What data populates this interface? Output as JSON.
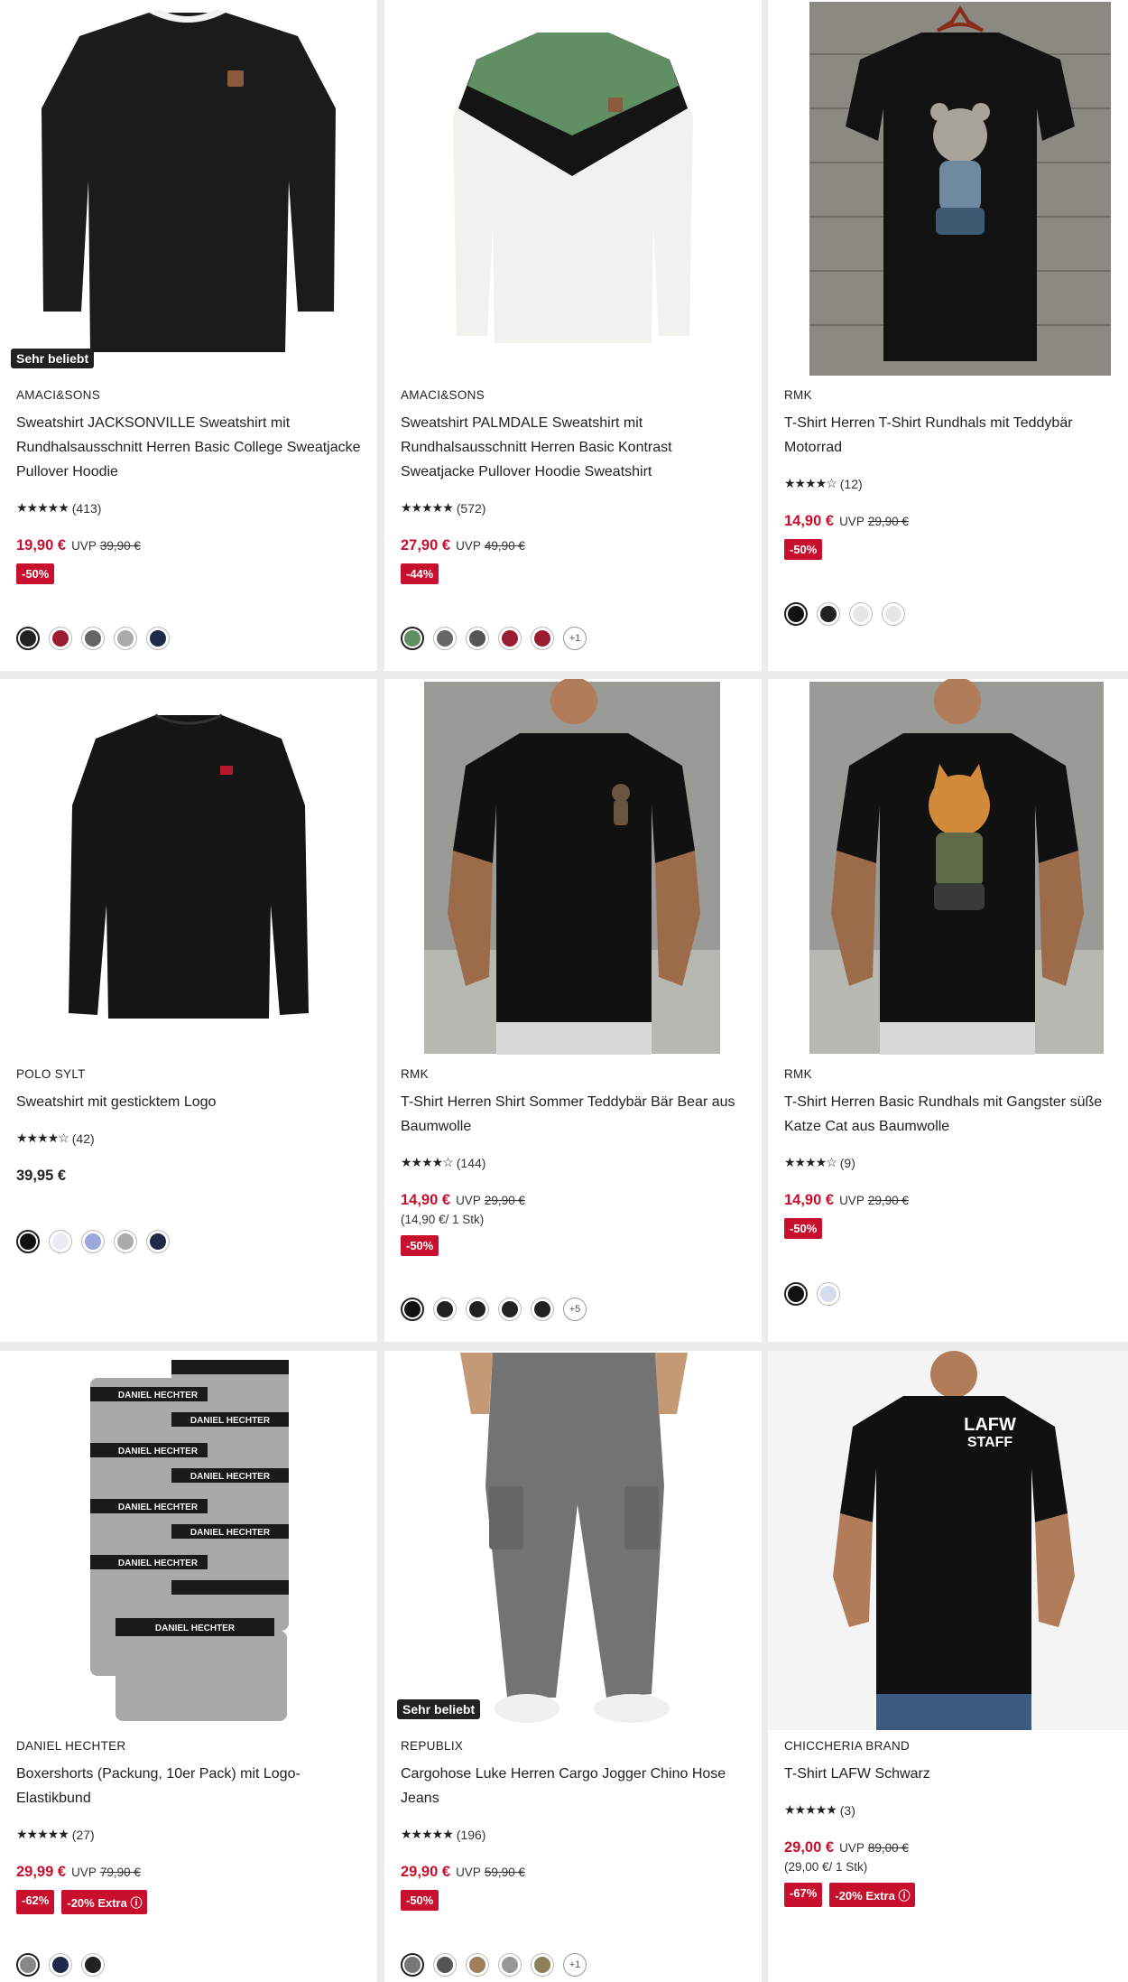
{
  "products": [
    {
      "brand": "AMACI&SONS",
      "title": "Sweatshirt JACKSONVILLE Sweatshirt mit Rundhalsausschnitt Herren Basic College Sweatjacke Pullover Hoodie",
      "badge": "Sehr beliebt",
      "stars": "★★★★★",
      "reviews": "(413)",
      "price": "19,90 €",
      "uvp_label": "UVP",
      "old_price": "39,90 €",
      "tags": [
        "-50%"
      ],
      "swatches": [
        "#222222",
        "#9b1b30",
        "#666666",
        "#aaaaaa",
        "#1e2a48"
      ],
      "more": ""
    },
    {
      "brand": "AMACI&SONS",
      "title": "Sweatshirt PALMDALE Sweatshirt mit Rundhalsausschnitt Herren Basic Kontrast Sweatjacke Pullover Hoodie Sweatshirt",
      "badge": "",
      "stars": "★★★★★",
      "reviews": "(572)",
      "price": "27,90 €",
      "uvp_label": "UVP",
      "old_price": "49,90 €",
      "tags": [
        "-44%"
      ],
      "swatches": [
        "#5f8f62",
        "#666666",
        "#555555",
        "#9b1b30",
        "#9b1b30"
      ],
      "more": "+1"
    },
    {
      "brand": "RMK",
      "title": "T-Shirt Herren T-Shirt Rundhals mit Teddybär Motorrad",
      "badge": "",
      "stars": "★★★★☆",
      "reviews": "(12)",
      "price": "14,90 €",
      "uvp_label": "UVP",
      "old_price": "29,90 €",
      "tags": [
        "-50%"
      ],
      "swatches": [
        "#111111",
        "#222222",
        "#e6e6e6",
        "#e6e6e6"
      ],
      "more": ""
    },
    {
      "brand": "POLO SYLT",
      "title": "Sweatshirt mit gesticktem Logo",
      "badge": "",
      "stars": "★★★★☆",
      "reviews": "(42)",
      "price": "39,95 €",
      "uvp_label": "",
      "old_price": "",
      "tags": [],
      "swatches": [
        "#111111",
        "#eceaf5",
        "#9aa8dc",
        "#aaaaaa",
        "#1e2a48"
      ],
      "more": ""
    },
    {
      "brand": "RMK",
      "title": "T-Shirt Herren Shirt Sommer Teddybär Bär Bear aus Baumwolle",
      "badge": "",
      "stars": "★★★★☆",
      "reviews": "(144)",
      "price": "14,90 €",
      "uvp_label": "UVP",
      "old_price": "29,90 €",
      "unit_price": "(14,90 €/ 1 Stk)",
      "tags": [
        "-50%"
      ],
      "swatches": [
        "#111111",
        "#222222",
        "#222222",
        "#222222",
        "#222222"
      ],
      "more": "+5"
    },
    {
      "brand": "RMK",
      "title": "T-Shirt Herren Basic Rundhals mit Gangster süße Katze Cat aus Baumwolle",
      "badge": "",
      "stars": "★★★★☆",
      "reviews": "(9)",
      "price": "14,90 €",
      "uvp_label": "UVP",
      "old_price": "29,90 €",
      "tags": [
        "-50%"
      ],
      "swatches": [
        "#111111",
        "#d5dcee"
      ],
      "more": ""
    },
    {
      "brand": "DANIEL HECHTER",
      "title": "Boxershorts (Packung, 10er Pack) mit Logo-Elastikbund",
      "badge": "",
      "stars": "★★★★★",
      "reviews": "(27)",
      "price": "29,99 €",
      "uvp_label": "UVP",
      "old_price": "79,90 €",
      "tags": [
        "-62%",
        "-20% Extra ⓘ"
      ],
      "swatches": [
        "#888888",
        "#1e2a48",
        "#222222"
      ],
      "more": ""
    },
    {
      "brand": "REPUBLIX",
      "title": "Cargohose Luke Herren Cargo Jogger Chino Hose Jeans",
      "badge": "Sehr beliebt",
      "stars": "★★★★★",
      "reviews": "(196)",
      "price": "29,90 €",
      "uvp_label": "UVP",
      "old_price": "59,90 €",
      "tags": [
        "-50%"
      ],
      "swatches": [
        "#777777",
        "#555555",
        "#a07e5a",
        "#999999",
        "#8f7e5a"
      ],
      "more": "+1"
    },
    {
      "brand": "CHICCHERIA BRAND",
      "title": "T-Shirt LAFW Schwarz",
      "badge": "",
      "stars": "★★★★★",
      "reviews": "(3)",
      "price": "29,00 €",
      "uvp_label": "UVP",
      "old_price": "89,00 €",
      "unit_price": "(29,00 €/ 1 Stk)",
      "tags": [
        "-67%",
        "-20% Extra ⓘ"
      ],
      "swatches": [],
      "more": ""
    }
  ],
  "print_texts": {
    "boxer_logo": "DANIEL HECHTER",
    "lafw": "LAFW",
    "staff": "STAFF"
  }
}
